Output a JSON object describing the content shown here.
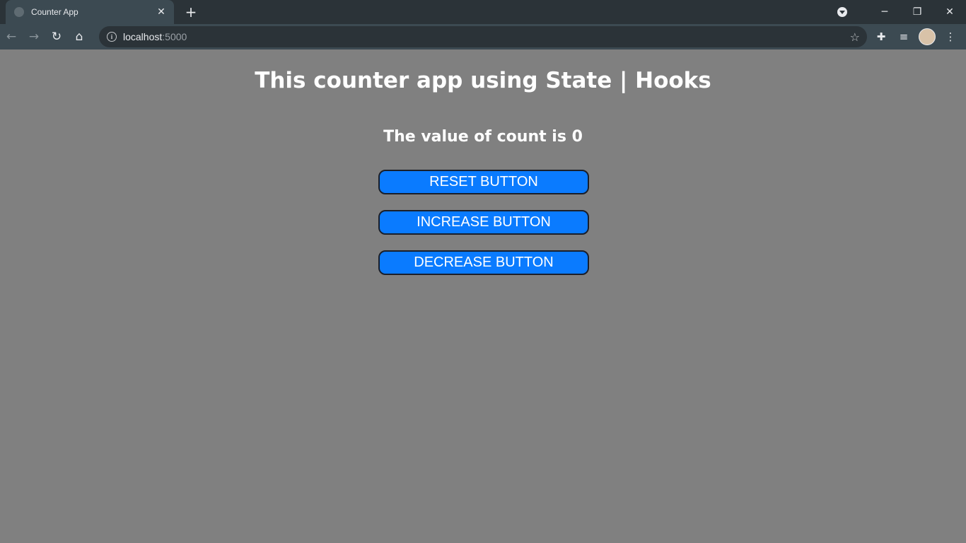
{
  "browser": {
    "tab_title": "Counter App",
    "tab_close": "✕",
    "new_tab": "+",
    "url_host": "localhost",
    "url_port": ":5000",
    "window": {
      "minimize": "─",
      "restore": "❐",
      "close": "✕"
    }
  },
  "page": {
    "heading": "This counter app using State | Hooks",
    "count_text": "The value of count is 0",
    "buttons": {
      "reset": "RESET BUTTON",
      "increase": "INCREASE BUTTON",
      "decrease": "DECREASE BUTTON"
    }
  },
  "colors": {
    "page_background": "#808080",
    "button_background": "#0a7bff",
    "button_text": "#ffffff"
  }
}
